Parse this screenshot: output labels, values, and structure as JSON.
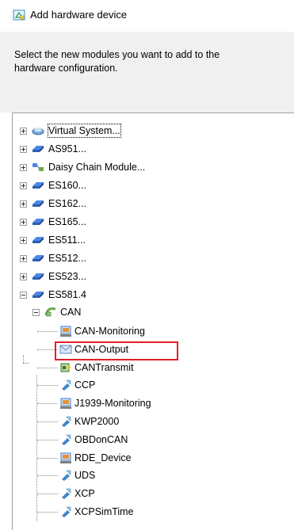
{
  "window": {
    "title": "Add hardware device",
    "icon": "add-hardware-icon"
  },
  "instructions": "Select the new modules you want to add to the hardware configuration.",
  "tree": {
    "top_level": [
      {
        "label": "Virtual System...",
        "icon": "virtual-system-icon",
        "expanded": false,
        "focused": true
      },
      {
        "label": "AS951...",
        "icon": "module-icon",
        "expanded": false
      },
      {
        "label": "Daisy Chain Module...",
        "icon": "daisy-chain-icon",
        "expanded": false
      },
      {
        "label": "ES160...",
        "icon": "module-icon",
        "expanded": false
      },
      {
        "label": "ES162...",
        "icon": "module-icon",
        "expanded": false
      },
      {
        "label": "ES165...",
        "icon": "module-icon",
        "expanded": false
      },
      {
        "label": "ES511...",
        "icon": "module-icon",
        "expanded": false
      },
      {
        "label": "ES512...",
        "icon": "module-icon",
        "expanded": false
      },
      {
        "label": "ES523...",
        "icon": "module-icon",
        "expanded": false
      },
      {
        "label": "ES581.4",
        "icon": "module-icon",
        "expanded": true
      }
    ],
    "can_node": {
      "label": "CAN",
      "icon": "can-icon",
      "expanded": true
    },
    "can_children": [
      {
        "label": "CAN-Monitoring",
        "icon": "monitor-icon"
      },
      {
        "label": "CAN-Output",
        "icon": "envelope-icon"
      },
      {
        "label": "CANTransmit",
        "icon": "transmit-icon"
      },
      {
        "label": "CCP",
        "icon": "protocol-icon"
      },
      {
        "label": "J1939-Monitoring",
        "icon": "monitor-icon"
      },
      {
        "label": "KWP2000",
        "icon": "protocol-icon"
      },
      {
        "label": "OBDonCAN",
        "icon": "protocol-icon"
      },
      {
        "label": "RDE_Device",
        "icon": "monitor-icon",
        "highlighted": true
      },
      {
        "label": "UDS",
        "icon": "protocol-icon"
      },
      {
        "label": "XCP",
        "icon": "protocol-icon"
      },
      {
        "label": "XCPSimTime",
        "icon": "protocol-icon"
      }
    ]
  },
  "colors": {
    "highlight_border": "#e21f26",
    "dialog_bg": "#f0f0f0",
    "module_blue": "#3a7bd5"
  }
}
